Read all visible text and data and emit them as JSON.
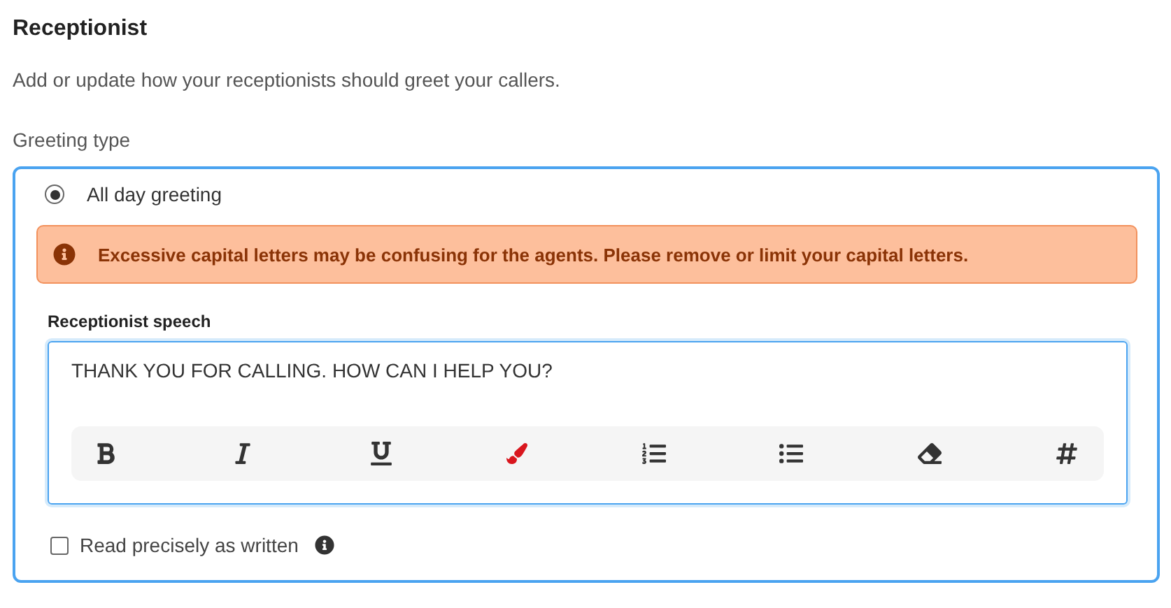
{
  "title": "Receptionist",
  "description": "Add or update how your receptionists should greet your callers.",
  "greeting_type": {
    "label": "Greeting type",
    "options": [
      {
        "label": "All day greeting",
        "selected": true
      }
    ]
  },
  "alert": {
    "message": "Excessive capital letters may be confusing for the agents. Please remove or limit your capital letters."
  },
  "speech": {
    "label": "Receptionist speech",
    "value": "THANK YOU FOR CALLING. HOW CAN I HELP YOU?",
    "toolbar": [
      {
        "kind": "bold"
      },
      {
        "kind": "italic"
      },
      {
        "kind": "underline"
      },
      {
        "kind": "color"
      },
      {
        "kind": "numbered-list"
      },
      {
        "kind": "bulleted-list"
      },
      {
        "kind": "eraser"
      },
      {
        "kind": "hashtag"
      }
    ]
  },
  "read_precisely": {
    "label": "Read precisely as written",
    "checked": false
  }
}
